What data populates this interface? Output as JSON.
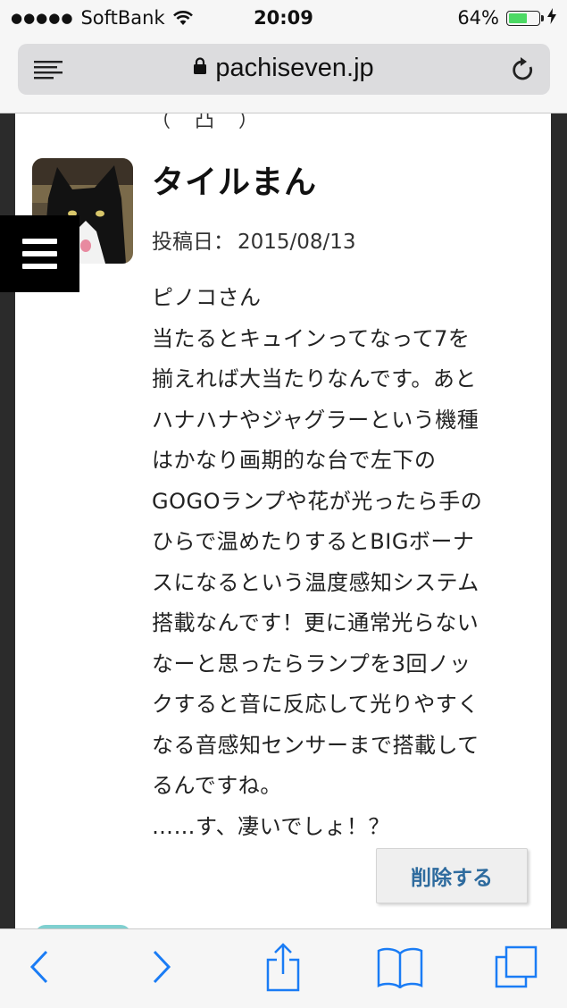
{
  "status_bar": {
    "carrier": "SoftBank",
    "time": "20:09",
    "battery_text": "64%",
    "battery_level": 0.64,
    "signal_dots": "●●●●●"
  },
  "browser": {
    "url": "pachiseven.jp",
    "icons": [
      "reader-icon",
      "lock-icon",
      "reload-icon"
    ]
  },
  "page": {
    "top_cut_text": "（ 凸 ）",
    "comment": {
      "author": "タイルまん",
      "date_label": "投稿日：",
      "date": "2015/08/13",
      "lines": [
        "ピノコさん",
        "当たるとキュインってなって7を",
        "揃えれば大当たりなんです。あと",
        "ハナハナやジャグラーという機種",
        "はかなり画期的な台で左下の",
        "GOGOランプや花が光ったら手の",
        "ひらで温めたりするとBIGボーナ",
        "スになるという温度感知システム",
        "搭載なんです！更に通常光らない",
        "なーと思ったらランプを3回ノッ",
        "クすると音に反応して光りやすく",
        "なる音感知センサーまで搭載して",
        "るんですね。",
        "……す、凄いでしょ！？"
      ],
      "delete_label": "削除する"
    }
  },
  "toolbar": {
    "icons": [
      "back-icon",
      "forward-icon",
      "share-icon",
      "bookmarks-icon",
      "tabs-icon"
    ]
  },
  "colors": {
    "accent": "#1a7cf5",
    "delete_text": "#2e6b9e",
    "battery": "#4cd964"
  }
}
